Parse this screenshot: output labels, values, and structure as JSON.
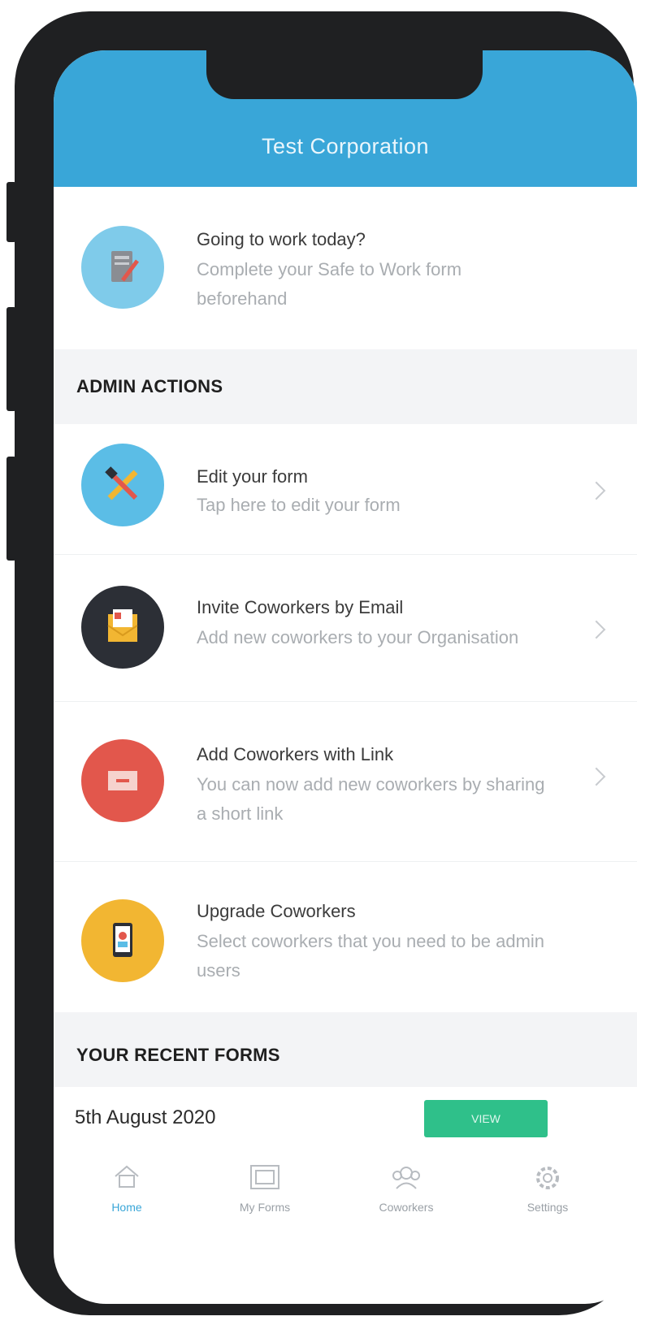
{
  "header": {
    "title": "Test Corporation"
  },
  "banner": {
    "title": "Going to work today?",
    "description": "Complete your Safe to Work form beforehand"
  },
  "admin_section": {
    "label": "ADMIN ACTIONS"
  },
  "admin_actions": [
    {
      "title": "Edit your form",
      "description": "Tap here to edit your form",
      "icon": "tools-icon",
      "color": "#5bbde6"
    },
    {
      "title": "Invite Coworkers by Email",
      "description": "Add new coworkers to your Organisation",
      "icon": "email-invite-icon",
      "color": "#2c2f36"
    },
    {
      "title": "Add Coworkers with Link",
      "description": "You can now add new coworkers by sharing a short link",
      "icon": "link-icon",
      "color": "#e2574c"
    },
    {
      "title": "Upgrade Coworkers",
      "description": "Select coworkers that you need to be admin users",
      "icon": "upgrade-user-icon",
      "color": "#f2b632"
    }
  ],
  "recent_section": {
    "label": "YOUR RECENT FORMS"
  },
  "recent_forms": [
    {
      "date": "5th August 2020",
      "button_label": "VIEW"
    }
  ],
  "tabs": [
    {
      "label": "Home",
      "icon": "home-icon",
      "active": true
    },
    {
      "label": "My Forms",
      "icon": "forms-icon",
      "active": false
    },
    {
      "label": "Coworkers",
      "icon": "coworkers-icon",
      "active": false
    },
    {
      "label": "Settings",
      "icon": "gear-icon",
      "active": false
    }
  ],
  "colors": {
    "header": "#39a6d8",
    "accent_green": "#2fc08a"
  }
}
